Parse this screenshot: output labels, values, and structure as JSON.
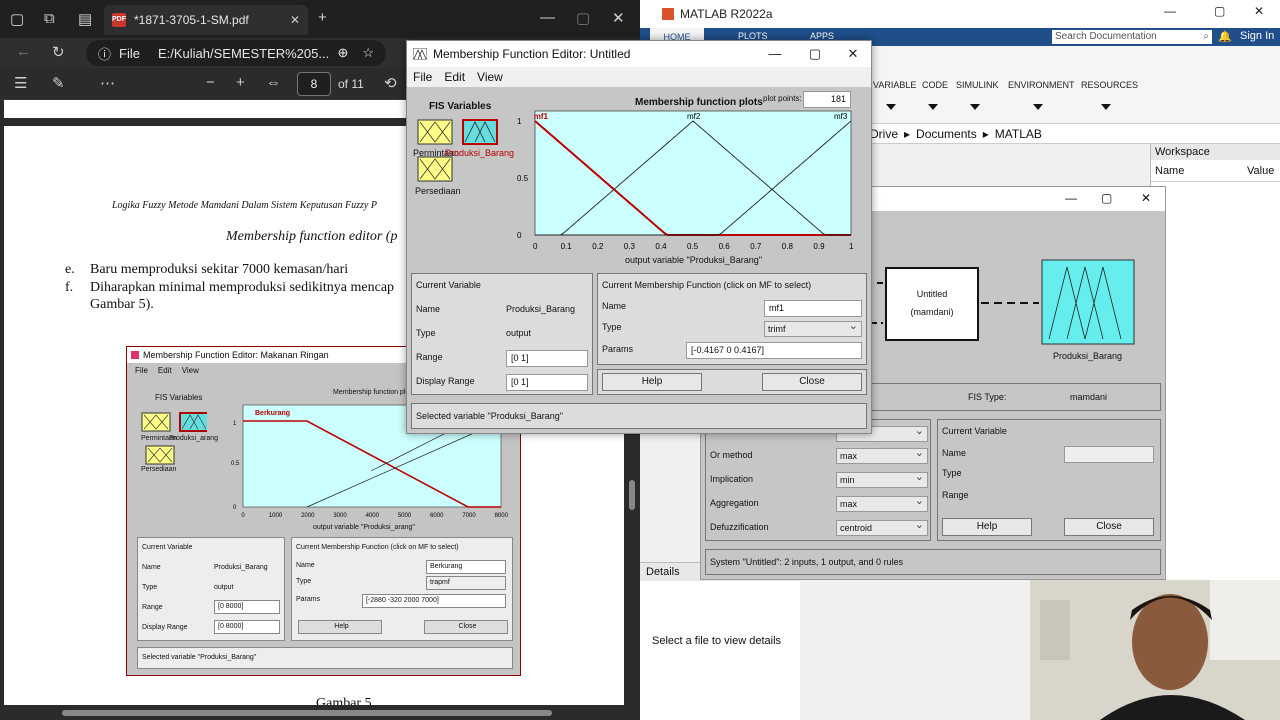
{
  "pdf": {
    "tab_title": "*1871-3705-1-SM.pdf",
    "file_label": "File",
    "address": "E:/Kuliah/SEMESTER%205...",
    "page_current": "8",
    "page_total": "of 11",
    "header_line": "Logika Fuzzy Metode Mamdani Dalam Sistem Keputusan Fuzzy P",
    "section_title": "Membership function editor (p",
    "item_e_marker": "e.",
    "item_e": "Baru memproduksi sekitar 7000 kemasan/hari",
    "item_f_marker": "f.",
    "item_f": "Diharapkan minimal memproduksi sedikitnya mencap",
    "item_f_cont": "Gambar 5).",
    "figure_caption": "Gambar 5"
  },
  "embedded_editor": {
    "title": "Membership Function Editor: Makanan Ringan",
    "menu": [
      "File",
      "Edit",
      "View"
    ],
    "fis_vars_label": "FIS Variables",
    "var_labels": [
      "Permintaan",
      "Produksi_arang",
      "Persediaan"
    ],
    "plot_title": "Membership function plot",
    "mf_label": "Berkurang",
    "xticks": [
      "0",
      "1000",
      "2000",
      "3000",
      "4000",
      "5000",
      "6000",
      "7000",
      "8000"
    ],
    "yticks": [
      "1",
      "0.5",
      "0"
    ],
    "xlabel": "output variable \"Produksi_arang\"",
    "current_variable_header": "Current Variable",
    "name_label": "Name",
    "name_value": "Produksi_Barang",
    "type_label": "Type",
    "type_value": "output",
    "range_label": "Range",
    "range_value": "[0 8000]",
    "display_range_label": "Display Range",
    "display_range_value": "[0 8000]",
    "cmf_header": "Current Membership Function (click on MF to select)",
    "mf_name_label": "Name",
    "mf_name_value": "Berkurang",
    "mf_type_label": "Type",
    "mf_type_value": "trapmf",
    "mf_params_label": "Params",
    "mf_params_value": "[-2880 -320 2000 7000]",
    "help": "Help",
    "close": "Close",
    "status": "Selected variable \"Produksi_Barang\""
  },
  "matlab": {
    "title": "MATLAB R2022a",
    "ribbon_tabs": [
      "HOME",
      "PLOTS",
      "APPS"
    ],
    "search_placeholder": "Search Documentation",
    "sign_in": "Sign In",
    "sections": [
      "VARIABLE",
      "CODE",
      "SIMULINK",
      "ENVIRONMENT",
      "RESOURCES"
    ],
    "path": [
      "Drive",
      "Documents",
      "MATLAB"
    ],
    "workspace_title": "Workspace",
    "ws_col_name": "Name",
    "ws_col_value": "Value",
    "details_title": "Details",
    "details_text": "Select a file to view details"
  },
  "fis_editor": {
    "box_untitled": "Untitled",
    "box_mamdani": "(mamdani)",
    "output_label": "Produksi_Barang",
    "fis_type_label": "FIS Type:",
    "fis_type_value": "mamdani",
    "or_method_label": "Or method",
    "or_method_value": "max",
    "implication_label": "Implication",
    "implication_value": "min",
    "aggregation_label": "Aggregation",
    "aggregation_value": "max",
    "defuzz_label": "Defuzzification",
    "defuzz_value": "centroid",
    "cv_header": "Current Variable",
    "cv_name": "Name",
    "cv_type": "Type",
    "cv_range": "Range",
    "help": "Help",
    "close": "Close",
    "status": "System \"Untitled\": 2 inputs, 1 output, and 0 rules"
  },
  "mf_editor": {
    "title": "Membership Function Editor: Untitled",
    "menu": [
      "File",
      "Edit",
      "View"
    ],
    "fis_vars_label": "FIS Variables",
    "var_labels": [
      "Permintaan",
      "Produksi_Barang",
      "Persediaan"
    ],
    "plot_title": "Membership function plots",
    "plot_points_label": "plot points:",
    "plot_points_value": "181",
    "mf_names": [
      "mf1",
      "mf2",
      "mf3"
    ],
    "xticks": [
      "0",
      "0.1",
      "0.2",
      "0.3",
      "0.4",
      "0.5",
      "0.6",
      "0.7",
      "0.8",
      "0.9",
      "1"
    ],
    "yticks": [
      "1",
      "0.5",
      "0"
    ],
    "xlabel": "output variable \"Produksi_Barang\"",
    "current_variable_header": "Current Variable",
    "name_label": "Name",
    "name_value": "Produksi_Barang",
    "type_label": "Type",
    "type_value": "output",
    "range_label": "Range",
    "range_value": "[0 1]",
    "display_range_label": "Display Range",
    "display_range_value": "[0 1]",
    "cmf_header": "Current Membership Function (click on MF to select)",
    "mf_name_label": "Name",
    "mf_name_value": "mf1",
    "mf_type_label": "Type",
    "mf_type_value": "trimf",
    "mf_params_label": "Params",
    "mf_params_value": "[-0.4167 0 0.4167]",
    "help": "Help",
    "close": "Close",
    "status": "Selected variable \"Produksi_Barang\""
  }
}
